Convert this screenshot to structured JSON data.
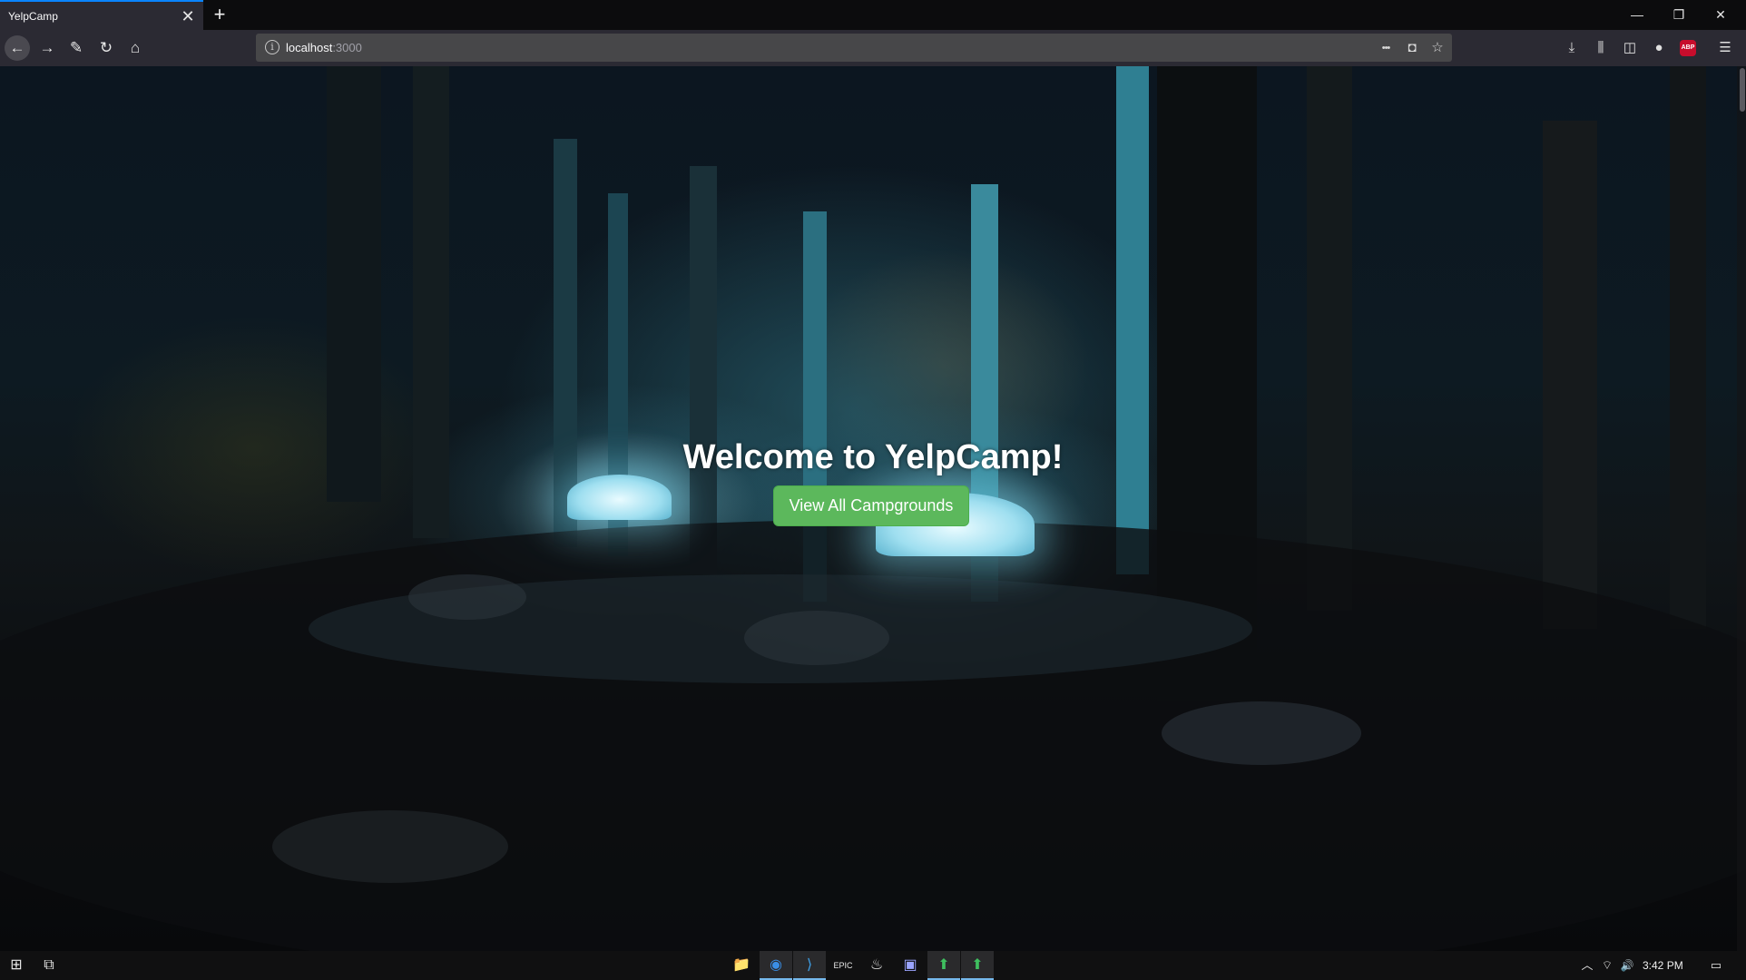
{
  "browser": {
    "tab_title": "YelpCamp",
    "tab_close": "✕",
    "new_tab": "+",
    "url_info": "i",
    "url_host": "localhost",
    "url_port": ":3000",
    "icons": {
      "back": "←",
      "forward": "→",
      "devtools": "✎",
      "reload": "↻",
      "home": "⌂",
      "page_actions": "•••",
      "pocket": "◘",
      "bookmark": "☆",
      "downloads": "⤓",
      "library": "⫼",
      "sidebar": "◫",
      "account": "●",
      "abp": "ABP",
      "menu": "☰",
      "minimize": "—",
      "restore": "❐",
      "close": "✕"
    }
  },
  "page": {
    "title": "Welcome to YelpCamp!",
    "button_label": "View All Campgrounds",
    "button_color": "#5cb85c"
  },
  "taskbar": {
    "start": "⊞",
    "task_view": "⧉",
    "apps": [
      "📁",
      "◉",
      "⟩",
      "EPIC",
      "♨",
      "▣",
      "⬆",
      "⬆"
    ],
    "tray_chevron": "︿",
    "network": "⌔",
    "volume": "🔊",
    "clock": "3:42 PM",
    "notifications": "▭"
  }
}
